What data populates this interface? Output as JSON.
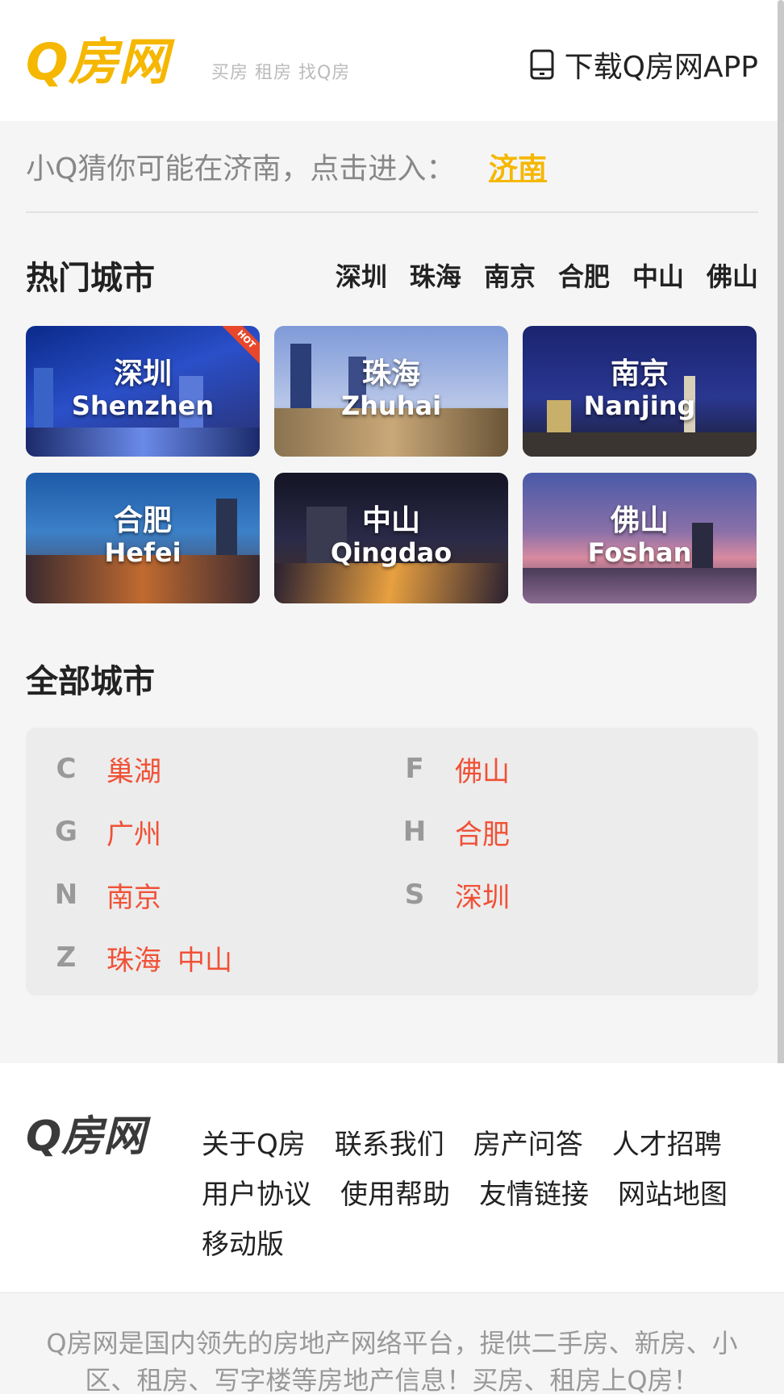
{
  "header": {
    "logo_text": "Q房网",
    "slogan": "买房 租房 找Q房",
    "download_label": "下载Q房网APP"
  },
  "guess": {
    "prompt": "小Q猜你可能在济南，点击进入：",
    "city": "济南"
  },
  "hot": {
    "title": "热门城市",
    "links": [
      "深圳",
      "珠海",
      "南京",
      "合肥",
      "中山",
      "佛山"
    ],
    "hot_badge": "HOT",
    "cards": [
      {
        "zh": "深圳",
        "en": "Shenzhen"
      },
      {
        "zh": "珠海",
        "en": "Zhuhai"
      },
      {
        "zh": "南京",
        "en": "Nanjing"
      },
      {
        "zh": "合肥",
        "en": "Hefei"
      },
      {
        "zh": "中山",
        "en": "Qingdao"
      },
      {
        "zh": "佛山",
        "en": "Foshan"
      }
    ]
  },
  "all": {
    "title": "全部城市",
    "groups": [
      {
        "letter": "C",
        "cities": [
          "巢湖"
        ]
      },
      {
        "letter": "F",
        "cities": [
          "佛山"
        ]
      },
      {
        "letter": "G",
        "cities": [
          "广州"
        ]
      },
      {
        "letter": "H",
        "cities": [
          "合肥"
        ]
      },
      {
        "letter": "N",
        "cities": [
          "南京"
        ]
      },
      {
        "letter": "S",
        "cities": [
          "深圳"
        ]
      },
      {
        "letter": "Z",
        "cities": [
          "珠海",
          "中山"
        ]
      }
    ]
  },
  "footer": {
    "logo_text": "Q房网",
    "links": [
      "关于Q房",
      "联系我们",
      "房产问答",
      "人才招聘",
      "用户协议",
      "使用帮助",
      "友情链接",
      "网站地图",
      "移动版"
    ],
    "description": "Q房网是国内领先的房地产网络平台，提供二手房、新房、小区、租房、写字楼等房地产信息！买房、租房上Q房！"
  },
  "colors": {
    "brand_yellow": "#f5b700",
    "city_red": "#f05136"
  },
  "icons": {
    "download": "tablet-icon"
  }
}
